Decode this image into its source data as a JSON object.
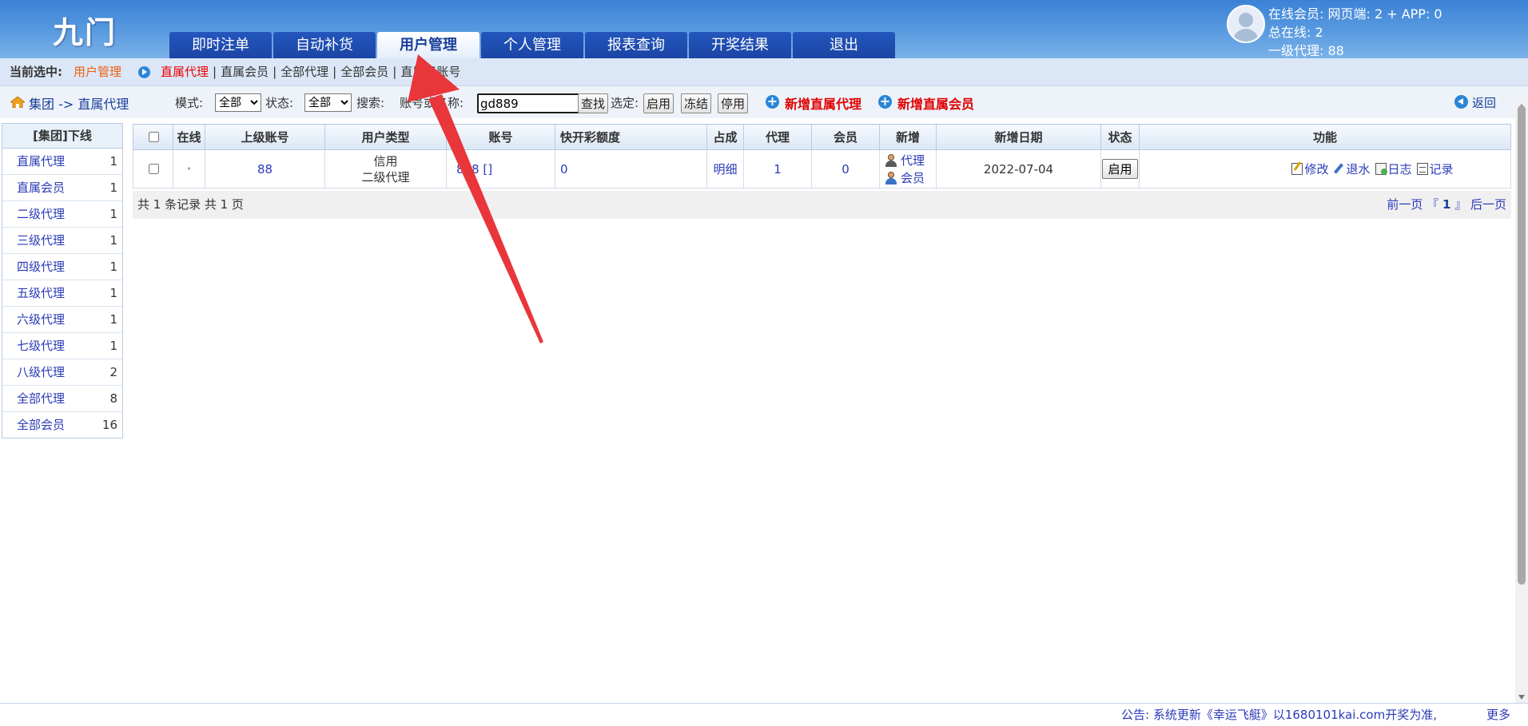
{
  "header": {
    "logo": "九门",
    "tabs": [
      {
        "label": "即时注单"
      },
      {
        "label": "自动补货"
      },
      {
        "label": "用户管理"
      },
      {
        "label": "个人管理"
      },
      {
        "label": "报表查询"
      },
      {
        "label": "开奖结果"
      },
      {
        "label": "退出"
      }
    ],
    "active_tab": "用户管理",
    "stats": {
      "line1": "在线会员:  网页端: 2 + APP: 0",
      "line2": "总在线: 2",
      "line3": "一级代理: 88"
    }
  },
  "subbar": {
    "label": "当前选中:",
    "current": "用户管理",
    "links": [
      "直属代理",
      "直属会员",
      "全部代理",
      "全部会员",
      "直属子账号"
    ],
    "selected_link": "直属代理"
  },
  "toolbar": {
    "breadcrumb": "集团 -> 直属代理",
    "mode_label": "模式:",
    "mode_value": "全部",
    "status_label": "状态:",
    "status_value": "全部",
    "search_label": "搜索:",
    "account_label": "账号或名称:",
    "search_value": "gd889",
    "find_button": "查找",
    "select_label": "选定:",
    "enable_button": "启用",
    "freeze_button": "冻结",
    "disable_button": "停用",
    "add_agent": "新增直属代理",
    "add_member": "新增直属会员",
    "back": "返回"
  },
  "left_panel": {
    "title": "[集团]下线",
    "items": [
      {
        "label": "直属代理",
        "count": "1"
      },
      {
        "label": "直属会员",
        "count": "1"
      },
      {
        "label": "二级代理",
        "count": "1"
      },
      {
        "label": "三级代理",
        "count": "1"
      },
      {
        "label": "四级代理",
        "count": "1"
      },
      {
        "label": "五级代理",
        "count": "1"
      },
      {
        "label": "六级代理",
        "count": "1"
      },
      {
        "label": "七级代理",
        "count": "1"
      },
      {
        "label": "八级代理",
        "count": "2"
      },
      {
        "label": "全部代理",
        "count": "8"
      },
      {
        "label": "全部会员",
        "count": "16"
      }
    ]
  },
  "table": {
    "columns": [
      "在线",
      "上级账号",
      "用户类型",
      "账号",
      "快开彩额度",
      "占成",
      "代理",
      "会员",
      "新增",
      "新增日期",
      "状态",
      "功能"
    ],
    "rows": [
      {
        "online": "•",
        "parent": "88",
        "type_line1": "信用",
        "type_line2": "二级代理",
        "account": "888 []",
        "quota": "0",
        "share": "明细",
        "agents": "1",
        "members": "0",
        "new_agent": "代理",
        "new_member": "会员",
        "date": "2022-07-04",
        "status_button": "启用",
        "functions": [
          "修改",
          "退水",
          "日志",
          "记录"
        ]
      }
    ]
  },
  "pager": {
    "info": "共 1 条记录 共 1 页",
    "prev": "前一页",
    "open": "『",
    "page": "1",
    "close": "』",
    "next": "后一页"
  },
  "footer": {
    "notice": "公告: 系统更新《幸运飞艇》以1680101kai.com开奖为准,",
    "more": "更多"
  },
  "colors": {
    "header_blue": "#3b82d6",
    "tab_blue": "#1b45a5",
    "link_blue": "#2a3ab8",
    "alert_red": "#e00000",
    "current_orange": "#f06010",
    "annotation_arrow": "#e8363a"
  }
}
